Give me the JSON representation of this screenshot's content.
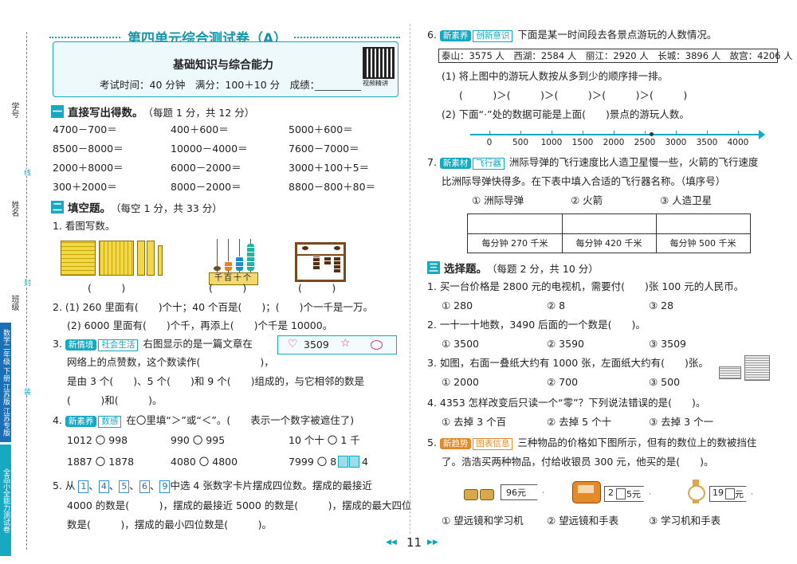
{
  "header": {
    "title": "第四单元综合测试卷（A）",
    "subtitle": "基础知识与综合能力",
    "exam_info": "考试时间：40 分钟　满分：100＋10 分　成绩：",
    "qr_caption": "视频精讲"
  },
  "margin": {
    "xuehao": "学号",
    "xingming": "姓名",
    "banji": "班级",
    "book_blue": "数学二年级 下册 江苏版 江苏专版",
    "book_teal": "全品小全能力测试卷",
    "line_a": "线",
    "line_b": "封",
    "line_c": "装"
  },
  "sec1": {
    "num": "一",
    "title": "直接写出得数。",
    "note": "（每题 1 分，共 12 分）",
    "items": [
      "4700－700＝",
      "400＋600＝",
      "5000＋600＝",
      "8500－8000＝",
      "10000－4000＝",
      "7600－7000＝",
      "2000＋8000＝",
      "6000－2000＝",
      "3000＋100＋5＝",
      "300＋2000＝",
      "8000－2000＝",
      "8800－800＋80＝"
    ]
  },
  "sec2": {
    "num": "二",
    "title": "填空题。",
    "note": "（每空 1 分，共 33 分）",
    "q1": "1. 看图写数。",
    "blank": "(　　　)",
    "abacus_label": "千百十个",
    "q2a": "2. (1) 260 里面有(　　)个十；40 个百是(　　)；(　　)个一千是一万。",
    "q2b": "(2) 6000 里面有(　　)个千，再添上(　　)个千是 10000。",
    "q3_num": "3.",
    "q3_tag": "新情境",
    "q3_tag2": "社会生活",
    "q3_l1": "右图显示的是一篇文章在",
    "q3_l2": "网络上的点赞数，这个数读作(　　　　　　)，",
    "q3_l3": "是由 3 个(　　)、5 个(　　)和 9 个(　　)组成的，与它相邻的数是",
    "q3_l4": "(　　　)和(　　　)。",
    "likes": "3509",
    "q4_num": "4.",
    "q4_tag": "新素养",
    "q4_tag2": "数感",
    "q4_text": "在〇里填“＞”或“＜”。(　　表示一个数字被遮住了)",
    "q4_items": [
      "1012 〇 998",
      "990 〇 995",
      "10 个十 〇 1 千",
      "1887 〇 1878",
      "4080 〇 4800",
      "7999 〇 8"
    ],
    "q4_tail": "4",
    "q5_l1a": "5. 从",
    "q5_cards": [
      "1",
      "4",
      "5",
      "6",
      "9"
    ],
    "q5_l1b": "中选 4 张数字卡片摆成四位数。摆成的最接近",
    "q5_l2": "4000 的数是(　　　)，摆成的最接近 5000 的数是(　　　)，摆成的最大四位",
    "q5_l3": "数是(　　　)，摆成的最小四位数是(　　　)。"
  },
  "q6": {
    "num": "6.",
    "tag": "新素养",
    "tag2": "创新意识",
    "text": "下面是某一时间段去各景点游玩的人数情况。",
    "table": "泰山：3575 人　西湖：2584 人　丽江：2920 人　长城：3896 人　故宫：4206 人",
    "p1": "(1) 将上图中的游玩人数按从多到少的顺序排一排。",
    "order": "(　　　)＞(　　　)＞(　　　)＞(　　　)＞(　　　)",
    "p2": "(2) 下面“·”处的数据可能是上面(　　)景点的游玩人数。",
    "ticks": [
      "0",
      "500",
      "1000",
      "1500",
      "2000",
      "2500",
      "3000",
      "3500",
      "4000"
    ],
    "dot_value": 2600,
    "axis_max": 4000
  },
  "q7": {
    "num": "7.",
    "tag": "新素材",
    "tag2": "飞行器",
    "l1": "洲际导弹的飞行速度比人造卫星慢一些，火箭的飞行速度",
    "l2": "比洲际导弹快得多。在下表中填入合适的飞行器名称。（填序号）",
    "opts": [
      "① 洲际导弹",
      "② 火箭",
      "③ 人造卫星"
    ],
    "speeds": [
      "每分钟 270 千米",
      "每分钟 420 千米",
      "每分钟 500 千米"
    ]
  },
  "sec3": {
    "num": "三",
    "title": "选择题。",
    "note": "（每题 2 分，共 10 分）",
    "q1": "1. 买一台价格是 2800 元的电视机，需要付(　　)张 100 元的人民币。",
    "q1_opts": [
      "① 280",
      "② 8",
      "③ 28"
    ],
    "q2": "2. 一十一十地数，3490 后面的一个数是(　　)。",
    "q2_opts": [
      "① 3500",
      "② 3590",
      "③ 3509"
    ],
    "q3": "3. 如图，右面一叠纸大约有 1000 张，左面纸大约有(　　)张。",
    "q3_opts": [
      "① 2000",
      "② 700",
      "③ 500"
    ],
    "q4": "4. 4353 怎样改变后只读一个“零”？下列说法错误的是(　　)。",
    "q4_opts": [
      "① 去掉 3 个百",
      "② 去掉 5 个十",
      "③ 去掉 3 个一"
    ],
    "q5_num": "5.",
    "q5_tag": "新趋势",
    "q5_tag2": "图表信息",
    "q5_l1": "三种物品的价格如下图所示，但有的数位上的数被挡住",
    "q5_l2": "了。浩浩买两种物品，付给收银员 300 元，他买的是(　　)。",
    "price1": "96元",
    "price2_a": "2",
    "price2_b": "5元",
    "price3_a": "19",
    "price3_b": "元",
    "q5_opts": [
      "① 望远镜和学习机",
      "② 望远镜和手表",
      "③ 学习机和手表"
    ]
  },
  "page_number": "11"
}
